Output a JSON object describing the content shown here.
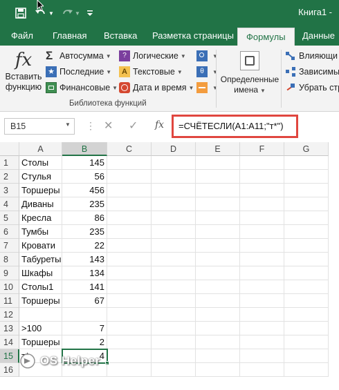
{
  "colors": {
    "brand": "#217346",
    "highlight": "#e0463f"
  },
  "titlebar": {
    "title": "Книга1 -"
  },
  "tabs": [
    "Файл",
    "Главная",
    "Вставка",
    "Разметка страницы",
    "Формулы",
    "Данные"
  ],
  "active_tab": "Формулы",
  "ribbon": {
    "insert_function": {
      "line1": "Вставить",
      "line2": "функцию",
      "icon": "fx"
    },
    "autosum": "Автосумма",
    "recent": "Последние",
    "financial": "Финансовые",
    "logical": "Логические",
    "text": "Текстовые",
    "datetime": "Дата и время",
    "group_label": "Библиотека функций",
    "defined_names": {
      "line1": "Определенные",
      "line2": "имена"
    },
    "trace_precedents": "Влияющи",
    "trace_dependents": "Зависимы",
    "remove_arrows": "Убрать стр"
  },
  "formula_bar": {
    "name_box": "B15",
    "fx": "fx",
    "formula": "=СЧЁТЕСЛИ(A1:A11;\"т*\")"
  },
  "sheet": {
    "columns": [
      "A",
      "B",
      "C",
      "D",
      "E",
      "F",
      "G"
    ],
    "selected_column": "B",
    "rows": [
      {
        "n": "1",
        "a": "Столы",
        "b": "145"
      },
      {
        "n": "2",
        "a": "Стулья",
        "b": "56"
      },
      {
        "n": "3",
        "a": "Торшеры",
        "b": "456"
      },
      {
        "n": "4",
        "a": "Диваны",
        "b": "235"
      },
      {
        "n": "5",
        "a": "Кресла",
        "b": "86"
      },
      {
        "n": "6",
        "a": "Тумбы",
        "b": "235"
      },
      {
        "n": "7",
        "a": "Кровати",
        "b": "22"
      },
      {
        "n": "8",
        "a": "Табуреты",
        "b": "143"
      },
      {
        "n": "9",
        "a": "Шкафы",
        "b": "134"
      },
      {
        "n": "10",
        "a": "Столы1",
        "b": "141"
      },
      {
        "n": "11",
        "a": "Торшеры",
        "b": "67"
      },
      {
        "n": "12",
        "a": "",
        "b": ""
      },
      {
        "n": "13",
        "a": ">100",
        "b": "7"
      },
      {
        "n": "14",
        "a": "Торшеры",
        "b": "2"
      },
      {
        "n": "15",
        "a": "т*",
        "b": "4"
      },
      {
        "n": "16",
        "a": "",
        "b": ""
      }
    ],
    "selected_row": "15"
  },
  "watermark": {
    "text": "OS Helper"
  }
}
